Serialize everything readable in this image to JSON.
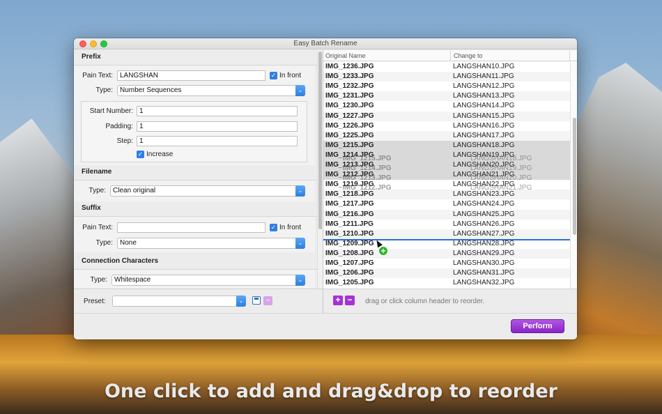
{
  "window": {
    "title": "Easy Batch Rename"
  },
  "prefix": {
    "heading": "Prefix",
    "pain_text_label": "Pain Text:",
    "pain_text_value": "LANGSHAN",
    "in_front_label": "In front",
    "in_front_checked": true,
    "type_label": "Type:",
    "type_value": "Number Sequences",
    "start_number_label": "Start Number:",
    "start_number_value": "1",
    "padding_label": "Padding:",
    "padding_value": "1",
    "step_label": "Step:",
    "step_value": "1",
    "increase_label": "Increase",
    "increase_checked": true
  },
  "filename": {
    "heading": "Filename",
    "type_label": "Type:",
    "type_value": "Clean original"
  },
  "suffix": {
    "heading": "Suffix",
    "pain_text_label": "Pain Text:",
    "pain_text_value": "",
    "in_front_label": "In front",
    "in_front_checked": true,
    "type_label": "Type:",
    "type_value": "None"
  },
  "connection": {
    "heading": "Connection Characters",
    "type_label": "Type:",
    "type_value": "Whitespace"
  },
  "preset": {
    "label": "Preset:",
    "value": ""
  },
  "table": {
    "headers": [
      "Original Name",
      "Change to"
    ],
    "rows": [
      {
        "original": "IMG_1236.JPG",
        "change": "LANGSHAN10.JPG"
      },
      {
        "original": "IMG_1233.JPG",
        "change": "LANGSHAN11.JPG"
      },
      {
        "original": "IMG_1232.JPG",
        "change": "LANGSHAN12.JPG"
      },
      {
        "original": "IMG_1231.JPG",
        "change": "LANGSHAN13.JPG"
      },
      {
        "original": "IMG_1230.JPG",
        "change": "LANGSHAN14.JPG"
      },
      {
        "original": "IMG_1227.JPG",
        "change": "LANGSHAN15.JPG"
      },
      {
        "original": "IMG_1226.JPG",
        "change": "LANGSHAN16.JPG"
      },
      {
        "original": "IMG_1225.JPG",
        "change": "LANGSHAN17.JPG"
      },
      {
        "original": "IMG_1215.JPG",
        "change": "LANGSHAN18.JPG"
      },
      {
        "original": "IMG_1214.JPG",
        "change": "LANGSHAN19.JPG"
      },
      {
        "original": "IMG_1213.JPG",
        "change": "LANGSHAN20.JPG"
      },
      {
        "original": "IMG_1212.JPG",
        "change": "LANGSHAN21.JPG"
      },
      {
        "original": "IMG_1219.JPG",
        "change": "LANGSHAN22.JPG"
      },
      {
        "original": "IMG_1218.JPG",
        "change": "LANGSHAN23.JPG"
      },
      {
        "original": "IMG_1217.JPG",
        "change": "LANGSHAN24.JPG"
      },
      {
        "original": "IMG_1216.JPG",
        "change": "LANGSHAN25.JPG"
      },
      {
        "original": "IMG_1211.JPG",
        "change": "LANGSHAN26.JPG"
      },
      {
        "original": "IMG_1210.JPG",
        "change": "LANGSHAN27.JPG"
      },
      {
        "original": "IMG_1209.JPG",
        "change": "LANGSHAN28.JPG"
      },
      {
        "original": "IMG_1208.JPG",
        "change": "LANGSHAN29.JPG"
      },
      {
        "original": "IMG_1207.JPG",
        "change": "LANGSHAN30.JPG"
      },
      {
        "original": "IMG_1206.JPG",
        "change": "LANGSHAN31.JPG"
      },
      {
        "original": "IMG_1205.JPG",
        "change": "LANGSHAN32.JPG"
      }
    ],
    "drag_ghost": [
      {
        "original": "IMG_1215.JPG",
        "change": "LANGSHAN18.JPG"
      },
      {
        "original": "IMG_1214.JPG",
        "change": "LANGSHAN19.JPG"
      },
      {
        "original": "IMG_1213.JPG",
        "change": "LANGSHAN20.JPG"
      },
      {
        "original": "IMG_1212.JPG",
        "change": "LANGSHAN21.JPG"
      }
    ]
  },
  "footer": {
    "add_icon": "plus-icon",
    "remove_icon": "minus-icon",
    "hint": "drag or click column header to reorder.",
    "perform_label": "Perform"
  },
  "caption": "One click to add and drag&drop to reorder",
  "colors": {
    "accent": "#2f7fe4",
    "perform": "#9a36d4",
    "add_remove": "#a533d4"
  }
}
